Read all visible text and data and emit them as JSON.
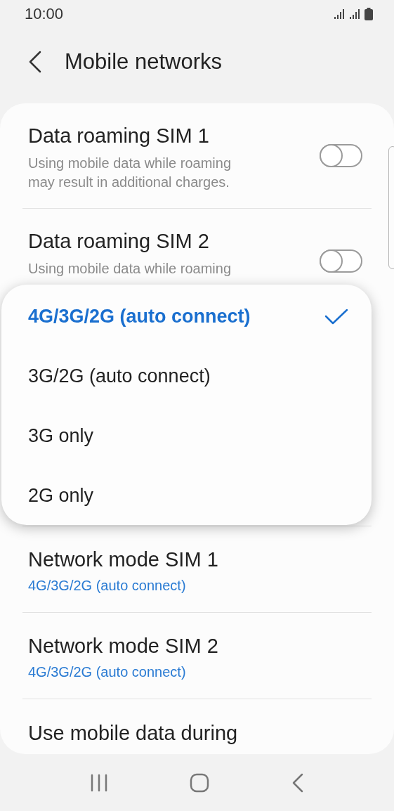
{
  "status_bar": {
    "time": "10:00"
  },
  "header": {
    "title": "Mobile networks"
  },
  "settings": [
    {
      "kind": "toggle",
      "title": "Data roaming SIM 1",
      "subtitle": [
        "Using mobile data while roaming",
        "may result in additional charges."
      ],
      "on": false
    },
    {
      "kind": "toggle",
      "title": "Data roaming SIM 2",
      "subtitle": [
        "Using mobile data while roaming"
      ],
      "on": false
    },
    {
      "kind": "value",
      "title": "Network mode SIM 1",
      "value": "4G/3G/2G (auto connect)"
    },
    {
      "kind": "value",
      "title": "Network mode SIM 2",
      "value": "4G/3G/2G (auto connect)"
    },
    {
      "kind": "plain",
      "title": "Use mobile data during"
    }
  ],
  "popup": {
    "options": [
      {
        "label": "4G/3G/2G (auto connect)",
        "selected": true
      },
      {
        "label": "3G/2G (auto connect)",
        "selected": false
      },
      {
        "label": "3G only",
        "selected": false
      },
      {
        "label": "2G only",
        "selected": false
      }
    ]
  }
}
